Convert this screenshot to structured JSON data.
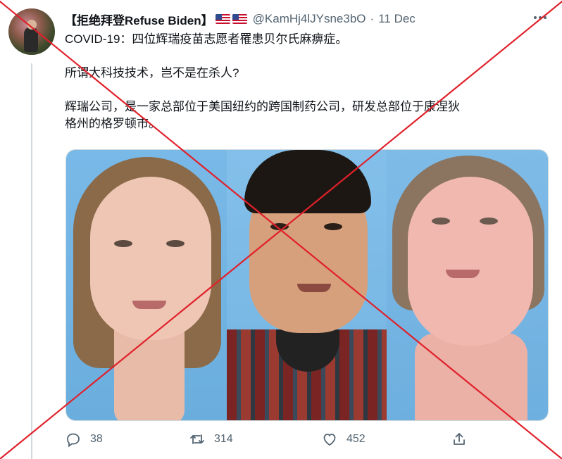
{
  "tweet": {
    "display_name": "【拒绝拜登Refuse Biden】",
    "flags": [
      "us-flag-icon",
      "us-flag-icon"
    ],
    "handle": "@KamHj4lJYsne3bO",
    "separator": "·",
    "date": "11 Dec",
    "text_lines": [
      "COVID-19：四位辉瑞疫苗志愿者罹患贝尔氏麻痹症。",
      "所谓大科技技术，岂不是在杀人?",
      "辉瑞公司，是一家总部位于美国纽约的跨国制药公司，研发总部位于康涅狄",
      "格州的格罗顿市。"
    ],
    "media": {
      "panels": [
        "photo-woman-left",
        "photo-man-center",
        "photo-woman-right"
      ]
    },
    "actions": {
      "reply_count": "38",
      "retweet_count": "314",
      "like_count": "452"
    }
  },
  "overlay": {
    "cross_color": "#e0202a"
  }
}
